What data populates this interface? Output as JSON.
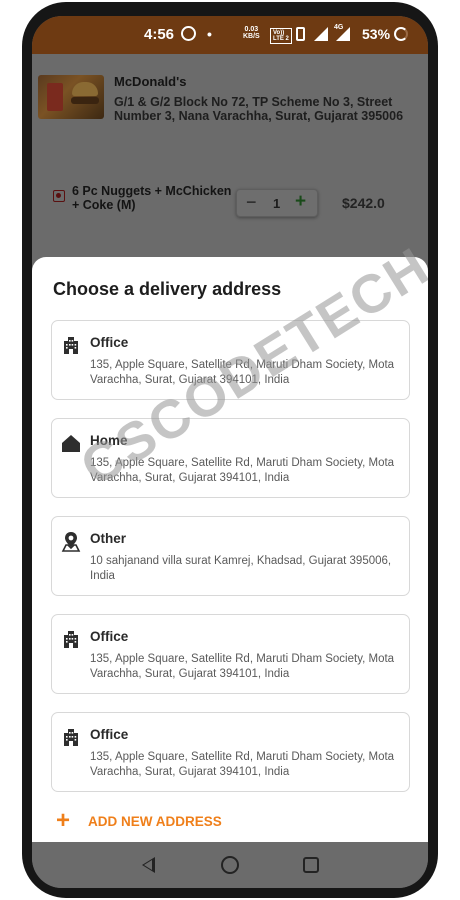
{
  "status_bar": {
    "time": "4:56",
    "speed_value": "0.03",
    "speed_unit": "KB/S",
    "volte_line1": "Vo))",
    "volte_line2": "LTE 2",
    "network": "4G",
    "battery": "53%"
  },
  "cart": {
    "restaurant_name": "McDonald's",
    "restaurant_address": "G/1 & G/2 Block No 72, TP Scheme No 3, Street Number 3, Nana Varachha, Surat, Gujarat 395006",
    "item_name": "6 Pc Nuggets + McChicken + Coke (M)",
    "quantity": "1",
    "price": "$242.0"
  },
  "sheet": {
    "title": "Choose a delivery address",
    "addresses": [
      {
        "label": "Office",
        "icon": "office-building-icon",
        "address": "135, Apple Square, Satellite Rd, Maruti Dham Society, Mota Varachha, Surat, Gujarat 394101, India"
      },
      {
        "label": "Home",
        "icon": "home-icon",
        "address": "135, Apple Square, Satellite Rd, Maruti Dham Society, Mota Varachha, Surat, Gujarat 394101, India"
      },
      {
        "label": "Other",
        "icon": "location-pin-icon",
        "address": "10 sahjanand villa surat Kamrej, Khadsad, Gujarat 395006, India"
      },
      {
        "label": "Office",
        "icon": "office-building-icon",
        "address": "135, Apple Square, Satellite Rd, Maruti Dham Society, Mota Varachha, Surat, Gujarat 394101, India"
      },
      {
        "label": "Office",
        "icon": "office-building-icon",
        "address": "135, Apple Square, Satellite Rd, Maruti Dham Society, Mota Varachha, Surat, Gujarat 394101, India"
      }
    ],
    "add_new_label": "ADD NEW ADDRESS"
  },
  "watermark": "CSCODETECH",
  "colors": {
    "accent": "#ef7f1a",
    "status_bar": "#6e3a12",
    "scrim": "#6b6b6b"
  }
}
